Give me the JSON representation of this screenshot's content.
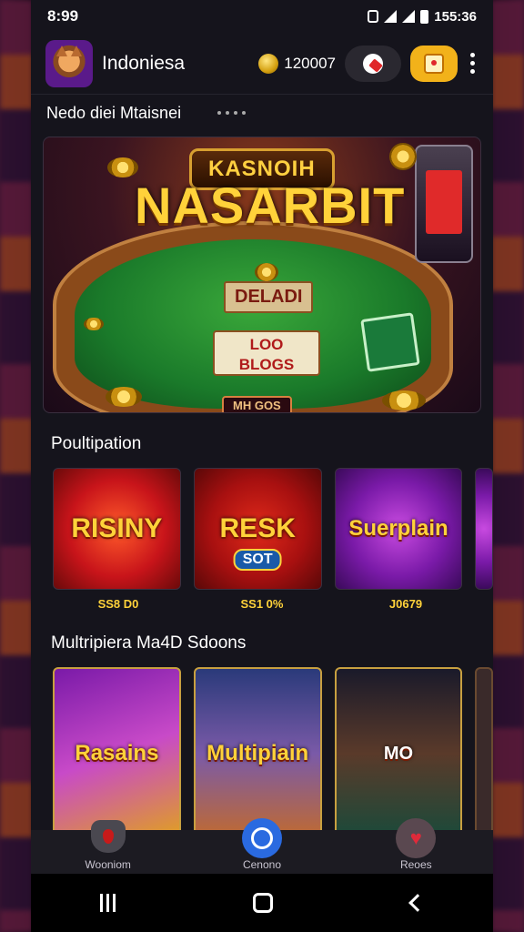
{
  "status_bar": {
    "time": "8:99",
    "right_text": "155:36"
  },
  "header": {
    "app_name": "Indoniesa",
    "coin_balance": "120007"
  },
  "featured": {
    "section_title": "Nedo diei Mtaisnei",
    "banner": {
      "subtitle": "KASNOIH",
      "title": "NASARBIT",
      "plaque": "DELADI",
      "cards_line1": "LOO",
      "cards_line2": "BLOGS",
      "bottom_label": "MH GOS"
    }
  },
  "row1": {
    "section_title": "Poultipation",
    "tiles": [
      {
        "label": "RISINY",
        "caption": "SS8 D0"
      },
      {
        "label": "RESK",
        "badge": "SOT",
        "caption": "SS1 0%"
      },
      {
        "label": "Suerplain",
        "caption": "J0679"
      }
    ]
  },
  "row2": {
    "section_title": "Multripiera Ma4D Sdoons",
    "tiles": [
      {
        "label": "Rasains"
      },
      {
        "label": "Multipiain"
      },
      {
        "label": "MO"
      }
    ]
  },
  "bottom_nav": {
    "items": [
      {
        "label": "Wooniom",
        "icon": "shield-icon"
      },
      {
        "label": "Cenono",
        "icon": "home-circle-icon"
      },
      {
        "label": "Reoes",
        "icon": "heart-icon"
      }
    ]
  },
  "colors": {
    "background": "#15141c",
    "accent_gold": "#f2b21a",
    "nav_blue": "#2a6ae0",
    "tile_text": "#ffd23a"
  }
}
